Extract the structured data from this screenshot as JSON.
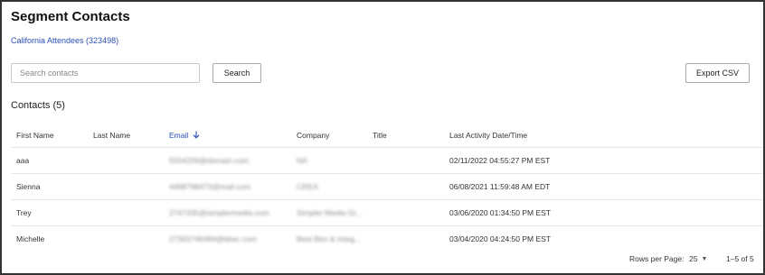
{
  "header": {
    "title": "Segment Contacts",
    "segment_link": "California Attendees (323498)"
  },
  "search": {
    "placeholder": "Search contacts",
    "value": "",
    "button_label": "Search"
  },
  "toolbar": {
    "export_label": "Export CSV"
  },
  "contacts": {
    "heading": "Contacts (5)",
    "columns": {
      "first_name": "First Name",
      "last_name": "Last Name",
      "email": "Email",
      "company": "Company",
      "title": "Title",
      "last_activity": "Last Activity Date/Time"
    },
    "sort": {
      "column": "email",
      "direction": "descending",
      "icon": "arrow-down-icon"
    },
    "rows": [
      {
        "first_name": "aaa",
        "last_name": "",
        "email": "5554209@domain.com",
        "company": "NA",
        "title": "",
        "last_activity": "02/11/2022 04:55:27 PM EST"
      },
      {
        "first_name": "Sienna",
        "last_name": "",
        "email": "4468798473@mail.com",
        "company": "CREA",
        "title": "",
        "last_activity": "06/08/2021 11:59:48 AM EDT"
      },
      {
        "first_name": "Trey",
        "last_name": "",
        "email": "2747335@simplermedia.com",
        "company": "Simpler Media Gr...",
        "title": "",
        "last_activity": "03/06/2020 01:34:50 PM EST"
      },
      {
        "first_name": "Michelle",
        "last_name": "",
        "email": "27303746484@bkec.com",
        "company": "Best Ben & Integ...",
        "title": "",
        "last_activity": "03/04/2020 04:24:50 PM EST"
      }
    ]
  },
  "pagination": {
    "rows_per_page_label": "Rows per Page:",
    "rows_per_page_value": "25",
    "range_text": "1–5 of 5"
  },
  "colors": {
    "link": "#2a4fb5",
    "border": "#333333",
    "row_divider": "#e6e6e6"
  }
}
